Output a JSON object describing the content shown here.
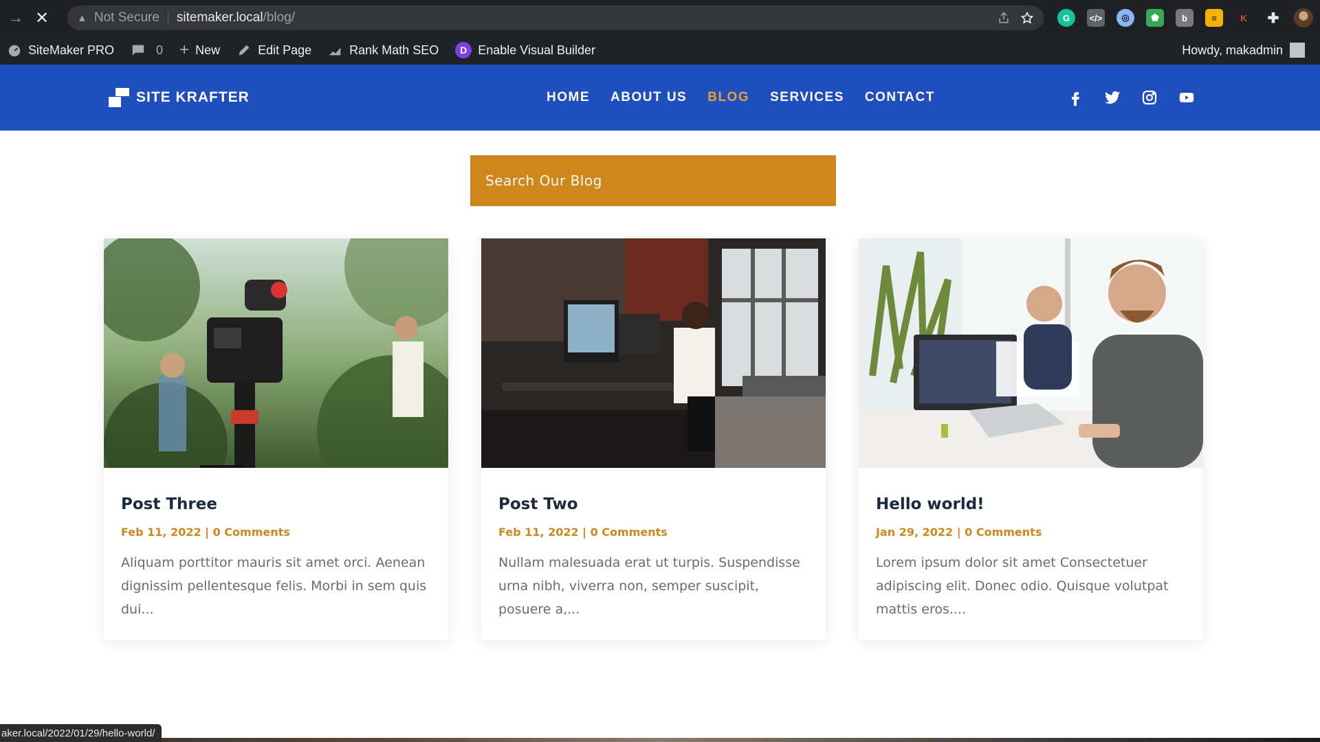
{
  "browser": {
    "back_icon": "arrow-right-icon",
    "stop_icon": "close-icon",
    "security_label": "Not Secure",
    "url_host": "sitemaker.local",
    "url_path": "/blog/"
  },
  "admin_bar": {
    "site_name": "SiteMaker PRO",
    "comments_count": "0",
    "new_label": "New",
    "edit_label": "Edit Page",
    "seo_label": "Rank Math SEO",
    "visual_builder_label": "Enable Visual Builder",
    "divi_letter": "D",
    "howdy_label": "Howdy, makadmin"
  },
  "header": {
    "logo_text": "SITE KRAFTER",
    "nav": [
      {
        "label": "HOME",
        "active": false
      },
      {
        "label": "ABOUT US",
        "active": false
      },
      {
        "label": "BLOG",
        "active": true
      },
      {
        "label": "SERVICES",
        "active": false
      },
      {
        "label": "CONTACT",
        "active": false
      }
    ],
    "social_icons": [
      "facebook-icon",
      "twitter-icon",
      "instagram-icon",
      "youtube-icon"
    ]
  },
  "search": {
    "placeholder": "Search Our Blog"
  },
  "posts": [
    {
      "title": "Post Three",
      "meta": "Feb 11, 2022 | 0 Comments",
      "excerpt": "Aliquam porttitor mauris sit amet orci. Aenean dignissim pellentesque felis. Morbi in sem quis dui..."
    },
    {
      "title": "Post Two",
      "meta": "Feb 11, 2022 | 0 Comments",
      "excerpt": "Nullam malesuada erat ut turpis. Suspendisse urna nibh, viverra non, semper suscipit, posuere a,..."
    },
    {
      "title": "Hello world!",
      "meta": "Jan 29, 2022 | 0 Comments",
      "excerpt": "Lorem ipsum dolor sit amet Consectetuer adipiscing elit. Donec odio. Quisque volutpat mattis eros...."
    }
  ],
  "status_url": "aker.local/2022/01/29/hello-world/",
  "colors": {
    "brand_blue": "#1f4fbe",
    "accent_orange": "#cd871d",
    "title_dark": "#1b2a40"
  }
}
